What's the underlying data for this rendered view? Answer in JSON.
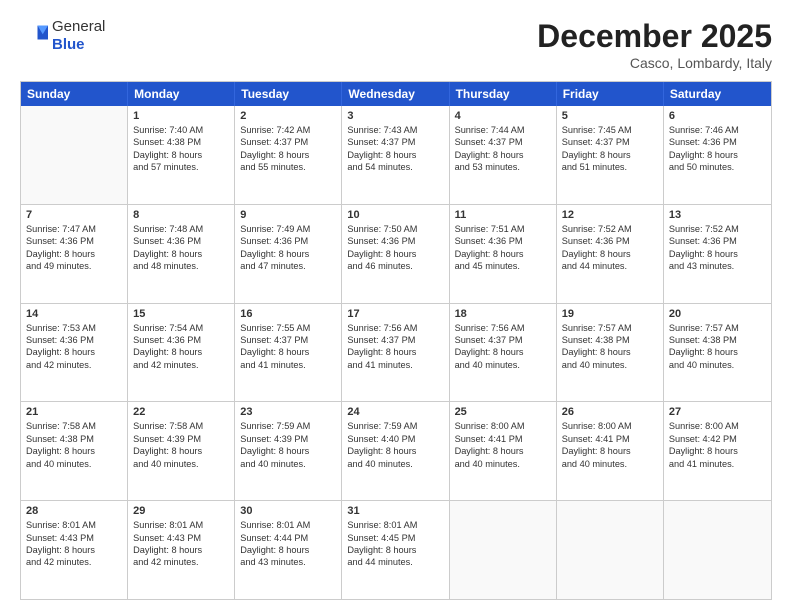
{
  "logo": {
    "general": "General",
    "blue": "Blue"
  },
  "header": {
    "month": "December 2025",
    "location": "Casco, Lombardy, Italy"
  },
  "weekdays": [
    "Sunday",
    "Monday",
    "Tuesday",
    "Wednesday",
    "Thursday",
    "Friday",
    "Saturday"
  ],
  "rows": [
    [
      {
        "day": "",
        "lines": [],
        "empty": true
      },
      {
        "day": "1",
        "lines": [
          "Sunrise: 7:40 AM",
          "Sunset: 4:38 PM",
          "Daylight: 8 hours",
          "and 57 minutes."
        ]
      },
      {
        "day": "2",
        "lines": [
          "Sunrise: 7:42 AM",
          "Sunset: 4:37 PM",
          "Daylight: 8 hours",
          "and 55 minutes."
        ]
      },
      {
        "day": "3",
        "lines": [
          "Sunrise: 7:43 AM",
          "Sunset: 4:37 PM",
          "Daylight: 8 hours",
          "and 54 minutes."
        ]
      },
      {
        "day": "4",
        "lines": [
          "Sunrise: 7:44 AM",
          "Sunset: 4:37 PM",
          "Daylight: 8 hours",
          "and 53 minutes."
        ]
      },
      {
        "day": "5",
        "lines": [
          "Sunrise: 7:45 AM",
          "Sunset: 4:37 PM",
          "Daylight: 8 hours",
          "and 51 minutes."
        ]
      },
      {
        "day": "6",
        "lines": [
          "Sunrise: 7:46 AM",
          "Sunset: 4:36 PM",
          "Daylight: 8 hours",
          "and 50 minutes."
        ]
      }
    ],
    [
      {
        "day": "7",
        "lines": [
          "Sunrise: 7:47 AM",
          "Sunset: 4:36 PM",
          "Daylight: 8 hours",
          "and 49 minutes."
        ]
      },
      {
        "day": "8",
        "lines": [
          "Sunrise: 7:48 AM",
          "Sunset: 4:36 PM",
          "Daylight: 8 hours",
          "and 48 minutes."
        ]
      },
      {
        "day": "9",
        "lines": [
          "Sunrise: 7:49 AM",
          "Sunset: 4:36 PM",
          "Daylight: 8 hours",
          "and 47 minutes."
        ]
      },
      {
        "day": "10",
        "lines": [
          "Sunrise: 7:50 AM",
          "Sunset: 4:36 PM",
          "Daylight: 8 hours",
          "and 46 minutes."
        ]
      },
      {
        "day": "11",
        "lines": [
          "Sunrise: 7:51 AM",
          "Sunset: 4:36 PM",
          "Daylight: 8 hours",
          "and 45 minutes."
        ]
      },
      {
        "day": "12",
        "lines": [
          "Sunrise: 7:52 AM",
          "Sunset: 4:36 PM",
          "Daylight: 8 hours",
          "and 44 minutes."
        ]
      },
      {
        "day": "13",
        "lines": [
          "Sunrise: 7:52 AM",
          "Sunset: 4:36 PM",
          "Daylight: 8 hours",
          "and 43 minutes."
        ]
      }
    ],
    [
      {
        "day": "14",
        "lines": [
          "Sunrise: 7:53 AM",
          "Sunset: 4:36 PM",
          "Daylight: 8 hours",
          "and 42 minutes."
        ]
      },
      {
        "day": "15",
        "lines": [
          "Sunrise: 7:54 AM",
          "Sunset: 4:36 PM",
          "Daylight: 8 hours",
          "and 42 minutes."
        ]
      },
      {
        "day": "16",
        "lines": [
          "Sunrise: 7:55 AM",
          "Sunset: 4:37 PM",
          "Daylight: 8 hours",
          "and 41 minutes."
        ]
      },
      {
        "day": "17",
        "lines": [
          "Sunrise: 7:56 AM",
          "Sunset: 4:37 PM",
          "Daylight: 8 hours",
          "and 41 minutes."
        ]
      },
      {
        "day": "18",
        "lines": [
          "Sunrise: 7:56 AM",
          "Sunset: 4:37 PM",
          "Daylight: 8 hours",
          "and 40 minutes."
        ]
      },
      {
        "day": "19",
        "lines": [
          "Sunrise: 7:57 AM",
          "Sunset: 4:38 PM",
          "Daylight: 8 hours",
          "and 40 minutes."
        ]
      },
      {
        "day": "20",
        "lines": [
          "Sunrise: 7:57 AM",
          "Sunset: 4:38 PM",
          "Daylight: 8 hours",
          "and 40 minutes."
        ]
      }
    ],
    [
      {
        "day": "21",
        "lines": [
          "Sunrise: 7:58 AM",
          "Sunset: 4:38 PM",
          "Daylight: 8 hours",
          "and 40 minutes."
        ]
      },
      {
        "day": "22",
        "lines": [
          "Sunrise: 7:58 AM",
          "Sunset: 4:39 PM",
          "Daylight: 8 hours",
          "and 40 minutes."
        ]
      },
      {
        "day": "23",
        "lines": [
          "Sunrise: 7:59 AM",
          "Sunset: 4:39 PM",
          "Daylight: 8 hours",
          "and 40 minutes."
        ]
      },
      {
        "day": "24",
        "lines": [
          "Sunrise: 7:59 AM",
          "Sunset: 4:40 PM",
          "Daylight: 8 hours",
          "and 40 minutes."
        ]
      },
      {
        "day": "25",
        "lines": [
          "Sunrise: 8:00 AM",
          "Sunset: 4:41 PM",
          "Daylight: 8 hours",
          "and 40 minutes."
        ]
      },
      {
        "day": "26",
        "lines": [
          "Sunrise: 8:00 AM",
          "Sunset: 4:41 PM",
          "Daylight: 8 hours",
          "and 40 minutes."
        ]
      },
      {
        "day": "27",
        "lines": [
          "Sunrise: 8:00 AM",
          "Sunset: 4:42 PM",
          "Daylight: 8 hours",
          "and 41 minutes."
        ]
      }
    ],
    [
      {
        "day": "28",
        "lines": [
          "Sunrise: 8:01 AM",
          "Sunset: 4:43 PM",
          "Daylight: 8 hours",
          "and 42 minutes."
        ]
      },
      {
        "day": "29",
        "lines": [
          "Sunrise: 8:01 AM",
          "Sunset: 4:43 PM",
          "Daylight: 8 hours",
          "and 42 minutes."
        ]
      },
      {
        "day": "30",
        "lines": [
          "Sunrise: 8:01 AM",
          "Sunset: 4:44 PM",
          "Daylight: 8 hours",
          "and 43 minutes."
        ]
      },
      {
        "day": "31",
        "lines": [
          "Sunrise: 8:01 AM",
          "Sunset: 4:45 PM",
          "Daylight: 8 hours",
          "and 44 minutes."
        ]
      },
      {
        "day": "",
        "lines": [],
        "empty": true
      },
      {
        "day": "",
        "lines": [],
        "empty": true
      },
      {
        "day": "",
        "lines": [],
        "empty": true
      }
    ]
  ]
}
